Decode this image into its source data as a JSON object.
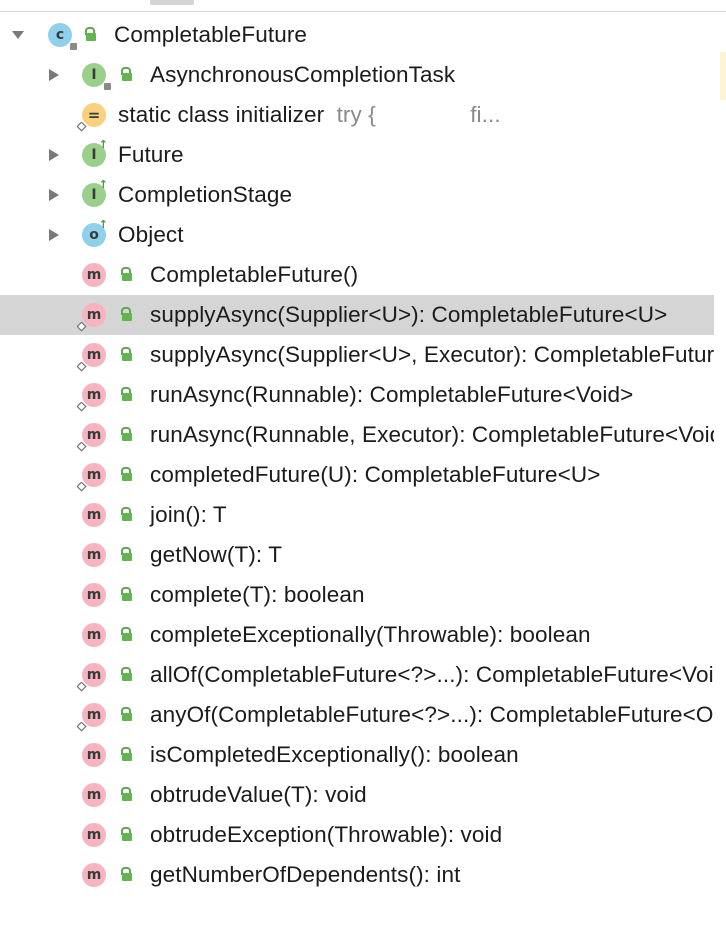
{
  "tree": {
    "root": {
      "label": "CompletableFuture",
      "icon": "class-icon"
    },
    "inner": [
      {
        "label": "AsynchronousCompletionTask",
        "icon": "interface-icon"
      }
    ],
    "initializer": {
      "label": "static class initializer",
      "hint": "try {",
      "hint2": "fi..."
    },
    "supertypes": [
      {
        "label": "Future",
        "icon": "interface-icon"
      },
      {
        "label": "CompletionStage",
        "icon": "interface-icon"
      },
      {
        "label": "Object",
        "icon": "object-icon"
      }
    ],
    "methods": [
      {
        "label": "CompletableFuture()",
        "static": false
      },
      {
        "label": "supplyAsync(Supplier<U>): CompletableFuture<U>",
        "static": true
      },
      {
        "label": "supplyAsync(Supplier<U>, Executor): CompletableFuture<U>",
        "static": true
      },
      {
        "label": "runAsync(Runnable): CompletableFuture<Void>",
        "static": true
      },
      {
        "label": "runAsync(Runnable, Executor): CompletableFuture<Void>",
        "static": true
      },
      {
        "label": "completedFuture(U): CompletableFuture<U>",
        "static": true
      },
      {
        "label": "join(): T",
        "static": false
      },
      {
        "label": "getNow(T): T",
        "static": false
      },
      {
        "label": "complete(T): boolean",
        "static": false
      },
      {
        "label": "completeExceptionally(Throwable): boolean",
        "static": false
      },
      {
        "label": "allOf(CompletableFuture<?>...): CompletableFuture<Void>",
        "static": true
      },
      {
        "label": "anyOf(CompletableFuture<?>...): CompletableFuture<Object>",
        "static": true
      },
      {
        "label": "isCompletedExceptionally(): boolean",
        "static": false
      },
      {
        "label": "obtrudeValue(T): void",
        "static": false
      },
      {
        "label": "obtrudeException(Throwable): void",
        "static": false
      },
      {
        "label": "getNumberOfDependents(): int",
        "static": false
      }
    ],
    "selected_method_index": 1
  },
  "icons": {
    "class_letter": "c",
    "interface_letter": "I",
    "object_letter": "o",
    "method_letter": "m",
    "initializer_glyph": "="
  },
  "colors": {
    "selection": "#d5d5d5",
    "class_icon": "#8fd0ea",
    "interface_icon": "#9ad08c",
    "method_icon": "#f7b3bf",
    "initializer_icon": "#f8d07e",
    "public_lock": "#63b450"
  }
}
